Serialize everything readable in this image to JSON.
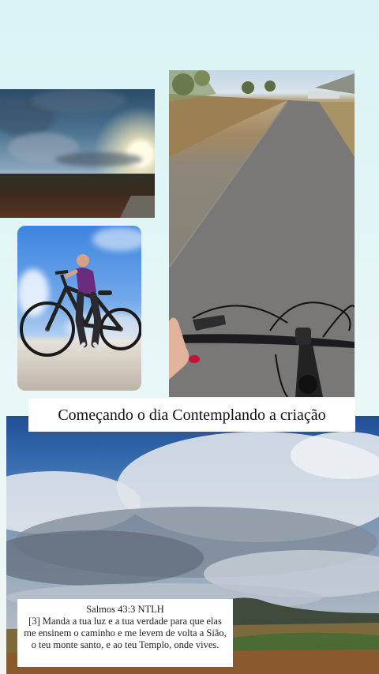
{
  "caption": "Começando o dia Contemplando a criação",
  "verse": {
    "reference": "Salmos 43:3 NTLH",
    "text": "[3] Manda a tua luz e a tua verdade para que elas me ensinem o caminho e me levem de volta a Sião, o teu monte santo, e ao teu Templo, onde vives."
  },
  "photos": {
    "sunset": "sunset-landscape-photo",
    "cyclist": "woman-with-bicycle-photo",
    "road": "handlebar-road-photo",
    "landscape": "cloudy-sky-landscape-photo"
  },
  "colors": {
    "background": "#dff4f4",
    "caption_bg": "#ffffff",
    "nail_polish": "#c4123a"
  }
}
